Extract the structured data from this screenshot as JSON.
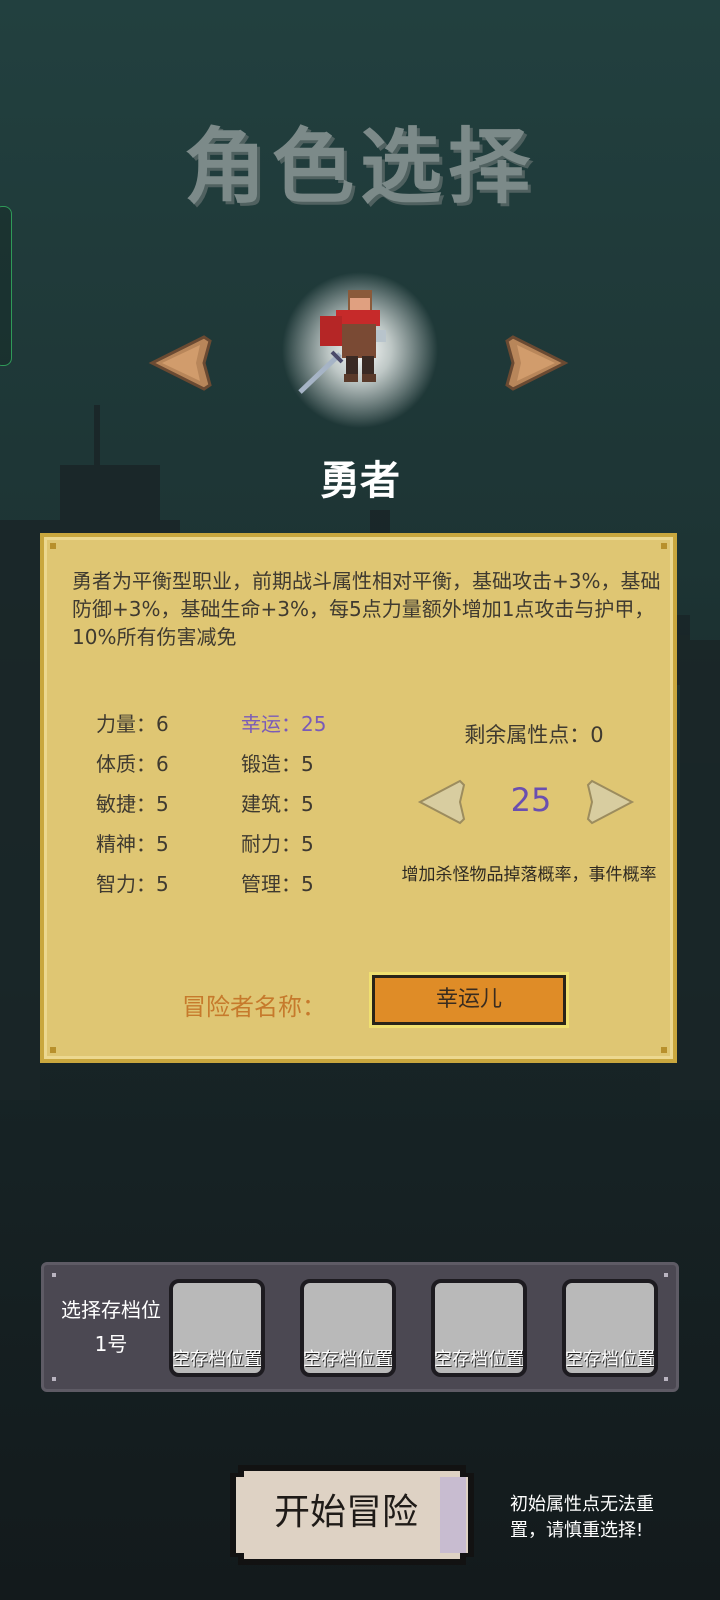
{
  "page_title": "角色选择",
  "hero": {
    "name": "勇者"
  },
  "description": "勇者为平衡型职业，前期战斗属性相对平衡，基础攻击+3%，基础防御+3%，基础生命+3%，每5点力量额外增加1点攻击与护甲，10%所有伤害减免",
  "attributes": [
    {
      "label": "力量：6"
    },
    {
      "label": "幸运：25"
    },
    {
      "label": "体质：6"
    },
    {
      "label": "锻造：5"
    },
    {
      "label": "敏捷：5"
    },
    {
      "label": "建筑：5"
    },
    {
      "label": "精神：5"
    },
    {
      "label": "耐力：5"
    },
    {
      "label": "智力：5"
    },
    {
      "label": "管理：5"
    }
  ],
  "selected_attribute": {
    "value": "25",
    "effect": "增加杀怪物品掉落概率，事件概率"
  },
  "remaining_points": "剩余属性点：0",
  "adventurer": {
    "label": "冒险者名称：",
    "value": "幸运儿"
  },
  "save": {
    "label_line1": "选择存档位",
    "label_line2": "1号",
    "slots": [
      {
        "label": "空存档位置"
      },
      {
        "label": "空存档位置"
      },
      {
        "label": "空存档位置"
      },
      {
        "label": "空存档位置"
      }
    ]
  },
  "start_button": "开始冒险",
  "warning": "初始属性点无法重置，请慎重选择!",
  "colors": {
    "panel": "#dfc673",
    "highlight_attr": "#7a5bb8",
    "name_input": "#df8c27",
    "save_bar": "#4b4852"
  },
  "icons": {
    "prev_hero": "arrow-left-icon",
    "next_hero": "arrow-right-icon",
    "hero_sprite": "hero-knight-sprite"
  }
}
